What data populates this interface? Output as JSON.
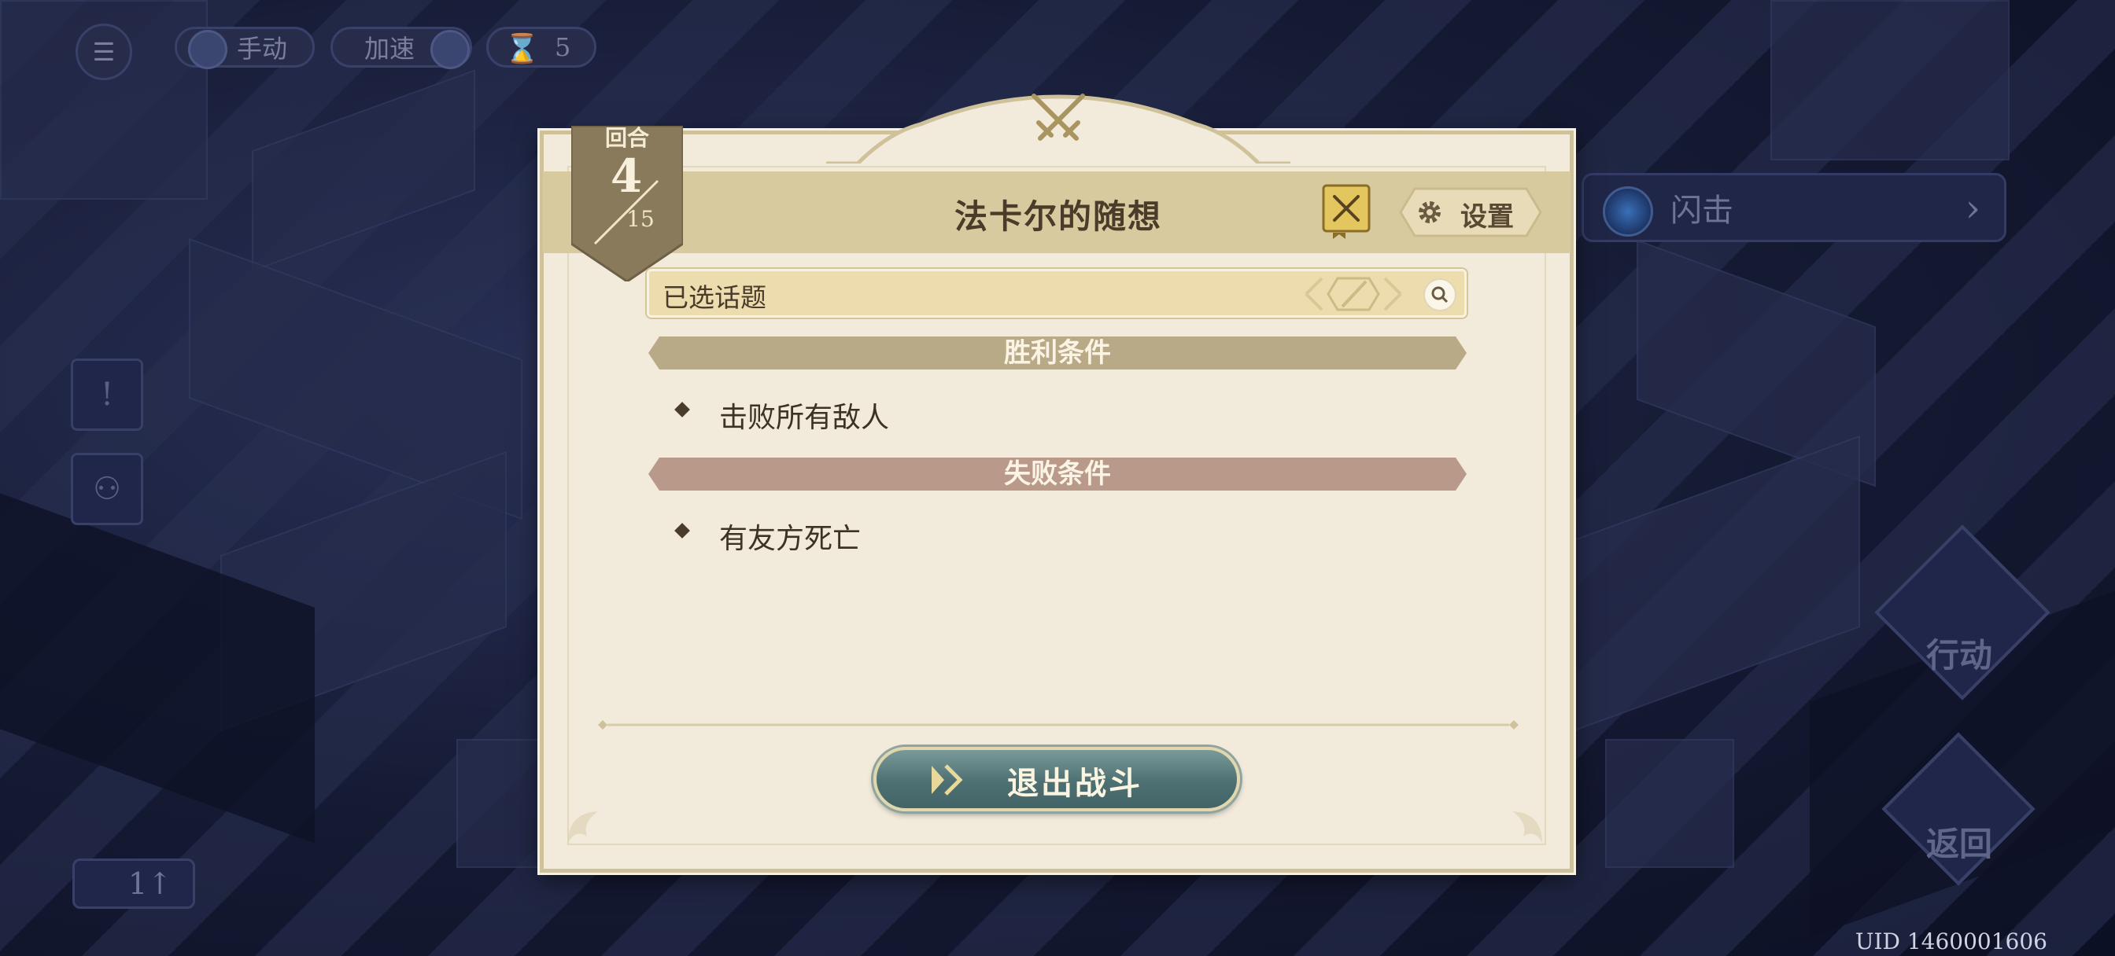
{
  "hud": {
    "mode_label": "手动",
    "speed_label": "加速",
    "turns_left": "5",
    "skill_label": "闪击",
    "action_label": "行动",
    "return_label": "返回",
    "level_label": "1",
    "uid": "UID 1460001606"
  },
  "dialog": {
    "title": "法卡尔的随想",
    "round_label": "回合",
    "round_current": "4",
    "round_total": "15",
    "settings_label": "设置",
    "topic_label": "已选话题",
    "victory_header": "胜利条件",
    "victory_items": [
      "击败所有敌人"
    ],
    "defeat_header": "失败条件",
    "defeat_items": [
      "有友方死亡"
    ],
    "exit_label": "退出战斗"
  },
  "colors": {
    "panel_bg": "#f2ebdb",
    "header_band": "#d8ca9f",
    "victory_bar": "#b8aa86",
    "defeat_bar": "#b8998a",
    "exit_button": "#4d7072"
  },
  "icons": [
    "menu-icon",
    "crossed-swords-icon",
    "book-icon",
    "gear-icon",
    "search-icon",
    "play-chevron-icon",
    "hourglass-icon"
  ]
}
